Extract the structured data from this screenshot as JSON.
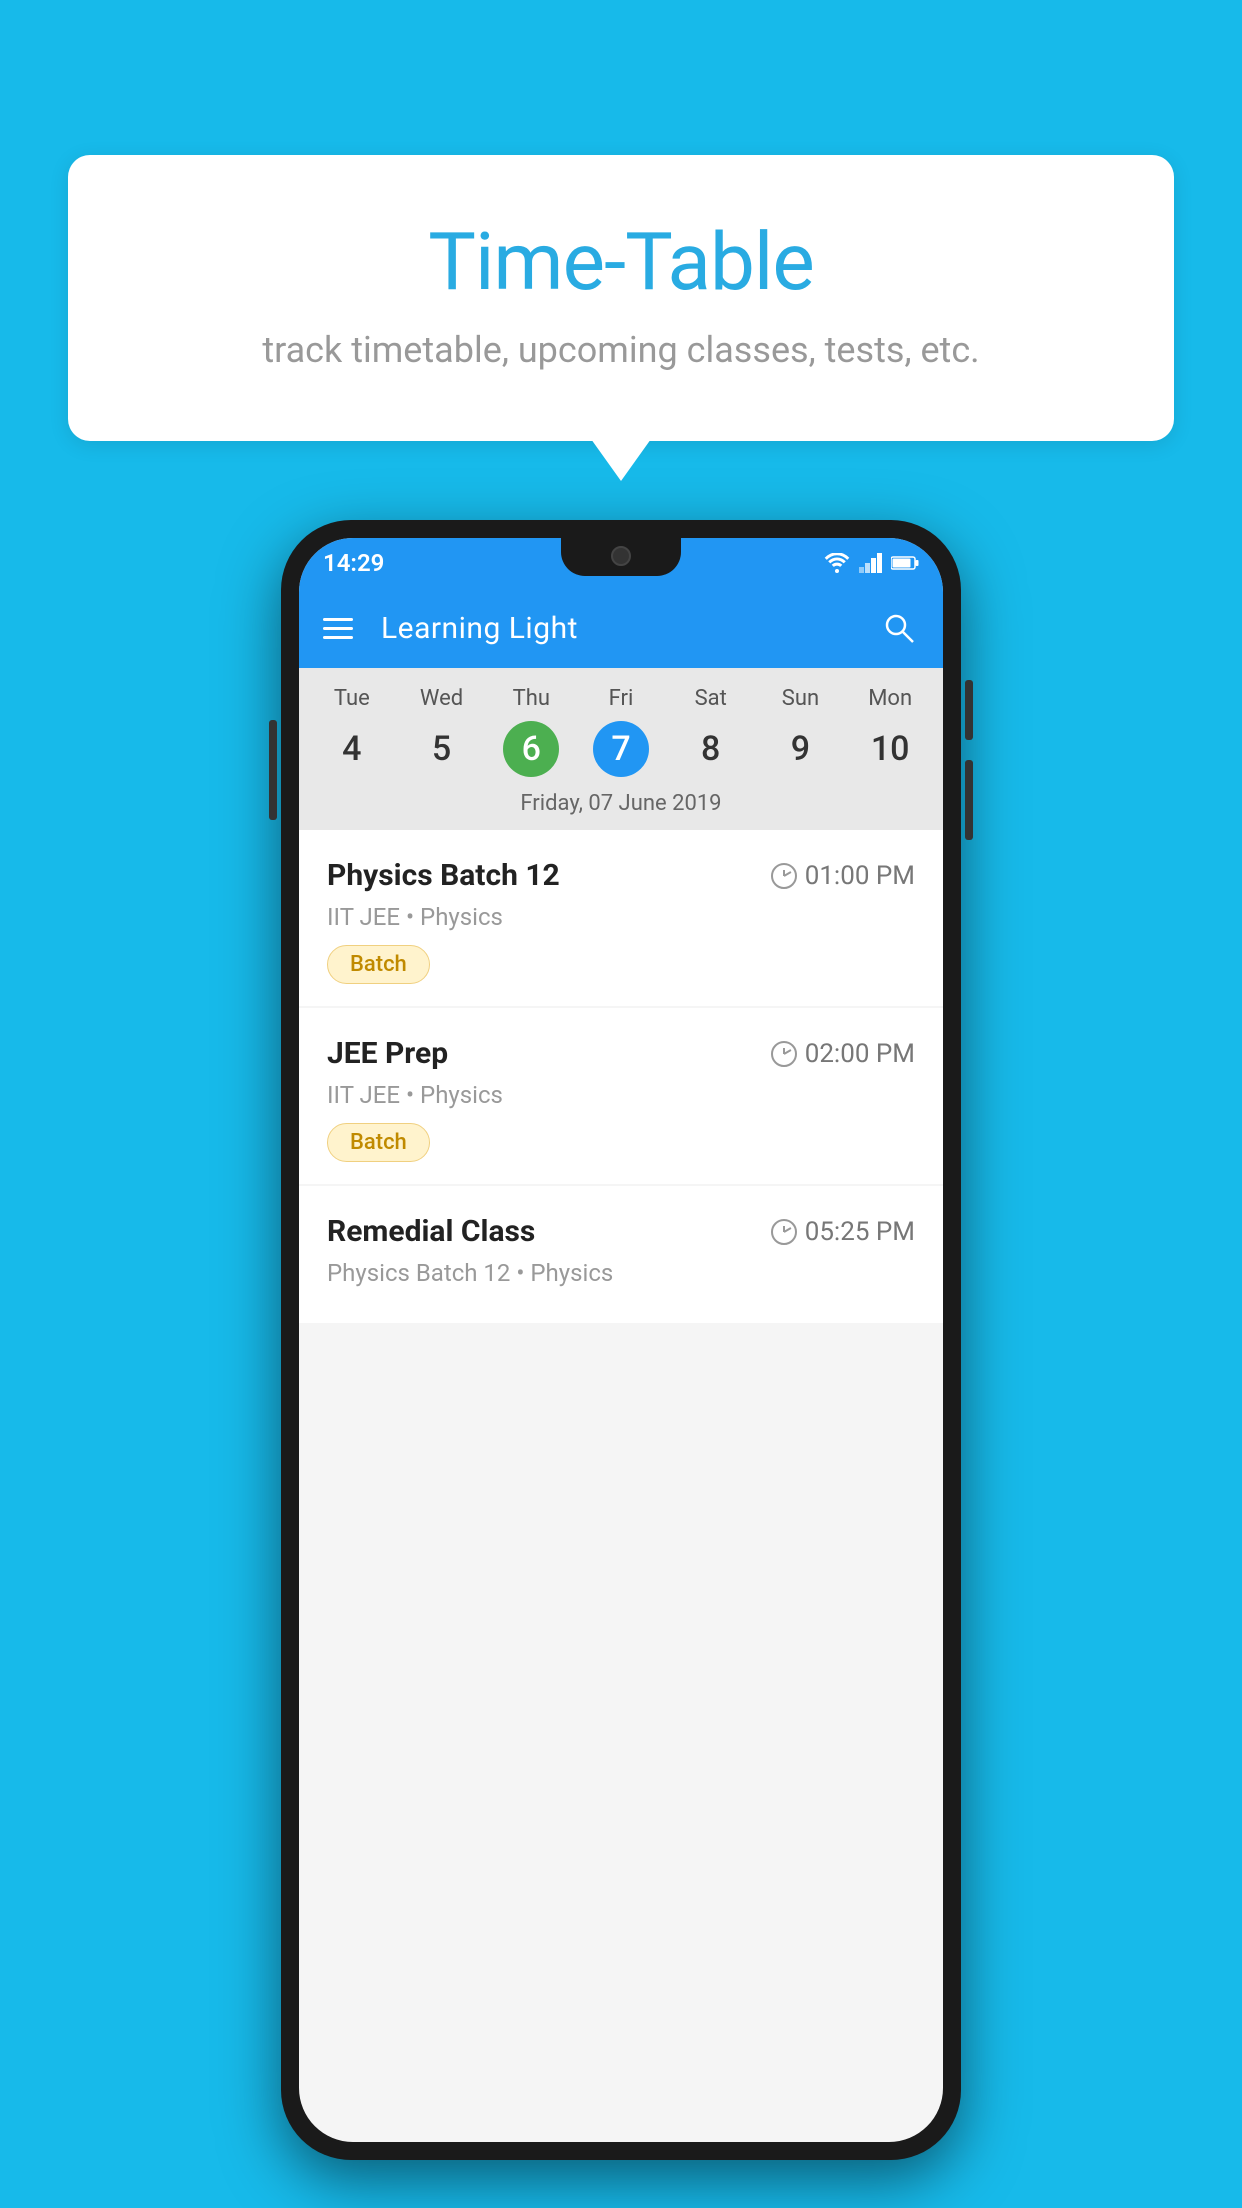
{
  "background": {
    "color": "#17BAEA"
  },
  "speech_bubble": {
    "title": "Time-Table",
    "subtitle": "track timetable, upcoming classes, tests, etc."
  },
  "phone": {
    "status_bar": {
      "time": "14:29"
    },
    "toolbar": {
      "title": "Learning Light",
      "hamburger_label": "menu",
      "search_label": "search"
    },
    "calendar": {
      "days": [
        {
          "label": "Tue",
          "number": "4"
        },
        {
          "label": "Wed",
          "number": "5"
        },
        {
          "label": "Thu",
          "number": "6",
          "state": "today"
        },
        {
          "label": "Fri",
          "number": "7",
          "state": "selected"
        },
        {
          "label": "Sat",
          "number": "8"
        },
        {
          "label": "Sun",
          "number": "9"
        },
        {
          "label": "Mon",
          "number": "10"
        }
      ],
      "selected_date_label": "Friday, 07 June 2019"
    },
    "schedule": [
      {
        "title": "Physics Batch 12",
        "time": "01:00 PM",
        "subtitle": "IIT JEE • Physics",
        "badge": "Batch"
      },
      {
        "title": "JEE Prep",
        "time": "02:00 PM",
        "subtitle": "IIT JEE • Physics",
        "badge": "Batch"
      },
      {
        "title": "Remedial Class",
        "time": "05:25 PM",
        "subtitle": "Physics Batch 12 • Physics",
        "badge": ""
      }
    ]
  }
}
